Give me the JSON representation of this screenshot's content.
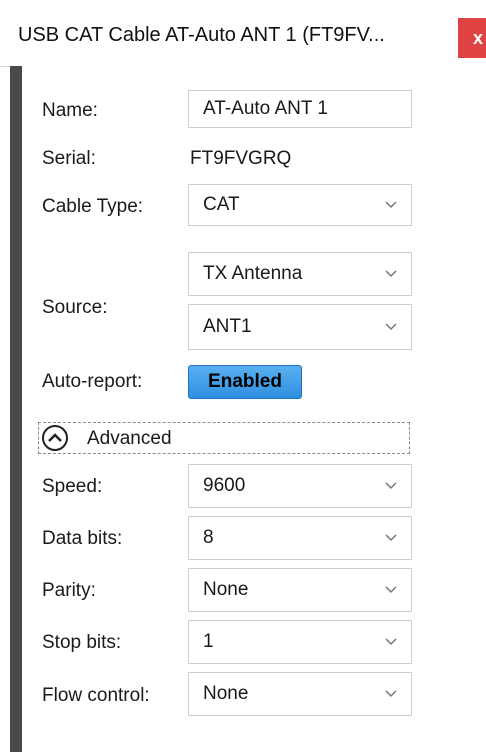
{
  "window": {
    "title": "USB CAT Cable AT-Auto ANT 1 (FT9FV...",
    "close_label": "x"
  },
  "form": {
    "name_label": "Name:",
    "name_value": "AT-Auto ANT 1",
    "serial_label": "Serial:",
    "serial_value": "FT9FVGRQ",
    "cable_type_label": "Cable Type:",
    "cable_type_value": "CAT",
    "source_label": "Source:",
    "source_value_1": "TX Antenna",
    "source_value_2": "ANT1",
    "auto_report_label": "Auto-report:",
    "auto_report_button": "Enabled",
    "advanced_label": "Advanced",
    "speed_label": "Speed:",
    "speed_value": "9600",
    "data_bits_label": "Data bits:",
    "data_bits_value": "8",
    "parity_label": "Parity:",
    "parity_value": "None",
    "stop_bits_label": "Stop bits:",
    "stop_bits_value": "1",
    "flow_control_label": "Flow control:",
    "flow_control_value": "None"
  },
  "colors": {
    "close_button": "#e04343",
    "enabled_button": "#3b9be6",
    "panel_border": "#4a4a4a"
  }
}
